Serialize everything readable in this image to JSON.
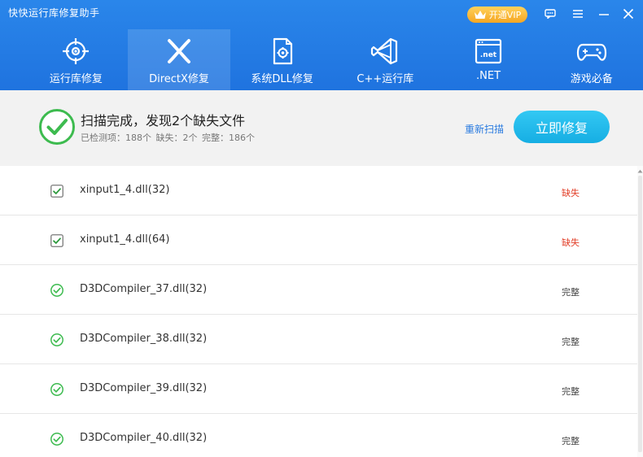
{
  "app": {
    "title": "快快运行库修复助手"
  },
  "vip": {
    "label": "开通VIP"
  },
  "tabs": [
    {
      "label": "运行库修复",
      "icon": "crosshair-icon",
      "active": false
    },
    {
      "label": "DirectX修复",
      "icon": "directx-icon",
      "active": true
    },
    {
      "label": "系统DLL修复",
      "icon": "dll-file-icon",
      "active": false
    },
    {
      "label": "C++运行库",
      "icon": "visual-studio-icon",
      "active": false
    },
    {
      "label": ".NET",
      "icon": "dotnet-window-icon",
      "active": false
    },
    {
      "label": "游戏必备",
      "icon": "gamepad-icon",
      "active": false
    }
  ],
  "status": {
    "title": "扫描完成，发现2个缺失文件",
    "checked": "已检测项：188个",
    "missing": "缺失：2个",
    "complete": "完整：186个",
    "rescan_label": "重新扫描",
    "fix_label": "立即修复"
  },
  "files": [
    {
      "name": "xinput1_4.dll(32)",
      "state": "缺失",
      "type": "missing"
    },
    {
      "name": "xinput1_4.dll(64)",
      "state": "缺失",
      "type": "missing"
    },
    {
      "name": "D3DCompiler_37.dll(32)",
      "state": "完整",
      "type": "ok"
    },
    {
      "name": "D3DCompiler_38.dll(32)",
      "state": "完整",
      "type": "ok"
    },
    {
      "name": "D3DCompiler_39.dll(32)",
      "state": "完整",
      "type": "ok"
    },
    {
      "name": "D3DCompiler_40.dll(32)",
      "state": "完整",
      "type": "ok"
    }
  ],
  "colors": {
    "header": "#2a86ea",
    "accent": "#1eb3e6",
    "missing": "#e2412b",
    "ok_green": "#3dbb4f"
  }
}
